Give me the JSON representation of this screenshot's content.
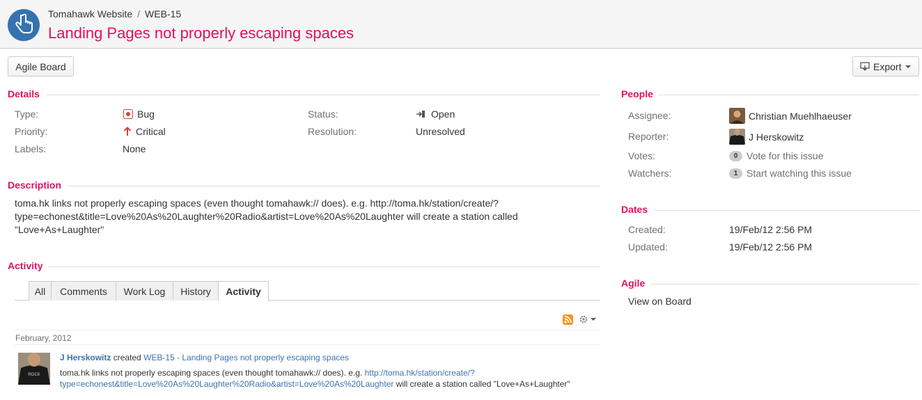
{
  "header": {
    "project": "Tomahawk Website",
    "separator": "/",
    "issue_key": "WEB-15",
    "title": "Landing Pages not properly escaping spaces"
  },
  "toolbar": {
    "agile_board": "Agile Board",
    "export": "Export"
  },
  "details": {
    "heading": "Details",
    "type_label": "Type:",
    "type_value": "Bug",
    "priority_label": "Priority:",
    "priority_value": "Critical",
    "labels_label": "Labels:",
    "labels_value": "None",
    "status_label": "Status:",
    "status_value": "Open",
    "resolution_label": "Resolution:",
    "resolution_value": "Unresolved"
  },
  "description": {
    "heading": "Description",
    "line1": "toma.hk links not properly escaping spaces (even thought tomahawk:// does). e.g. http://toma.hk/station/create/?",
    "line2": "type=echonest&title=Love%20As%20Laughter%20Radio&artist=Love%20As%20Laughter will create a station called",
    "line3": "\"Love+As+Laughter\""
  },
  "activity": {
    "heading": "Activity",
    "tabs": [
      {
        "label": "All"
      },
      {
        "label": "Comments"
      },
      {
        "label": "Work Log"
      },
      {
        "label": "History"
      },
      {
        "label": "Activity"
      }
    ],
    "date_group": "February, 2012",
    "entry": {
      "user": "J Herskowitz",
      "verb": "created",
      "issue_link": "WEB-15 - Landing Pages not properly escaping spaces",
      "body_text1": "toma.hk links not properly escaping spaces (even thought tomahawk:// does). e.g. ",
      "body_link1": "http://toma.hk/station/create/?",
      "body_link2": "type=echonest&title=Love%20As%20Laughter%20Radio&artist=Love%20As%20Laughter",
      "body_text2": " will create a station called \"Love+As+Laughter\""
    }
  },
  "people": {
    "heading": "People",
    "assignee_label": "Assignee:",
    "assignee_value": "Christian Muehlhaeuser",
    "reporter_label": "Reporter:",
    "reporter_value": "J Herskowitz",
    "votes_label": "Votes:",
    "votes_count": "0",
    "votes_link": "Vote for this issue",
    "watchers_label": "Watchers:",
    "watchers_count": "1",
    "watchers_link": "Start watching this issue"
  },
  "dates": {
    "heading": "Dates",
    "created_label": "Created:",
    "created_value": "19/Feb/12 2:56 PM",
    "updated_label": "Updated:",
    "updated_value": "19/Feb/12 2:56 PM"
  },
  "agile": {
    "heading": "Agile",
    "view_on_board": "View on Board"
  },
  "colors": {
    "accent": "#e0115f",
    "link": "#3b73af",
    "project_avatar": "#3572b0"
  },
  "icons": [
    "pointer-hand-icon",
    "bug-icon",
    "critical-priority-icon",
    "open-status-icon",
    "export-icon",
    "caret-down-icon",
    "rss-icon",
    "gear-icon"
  ]
}
